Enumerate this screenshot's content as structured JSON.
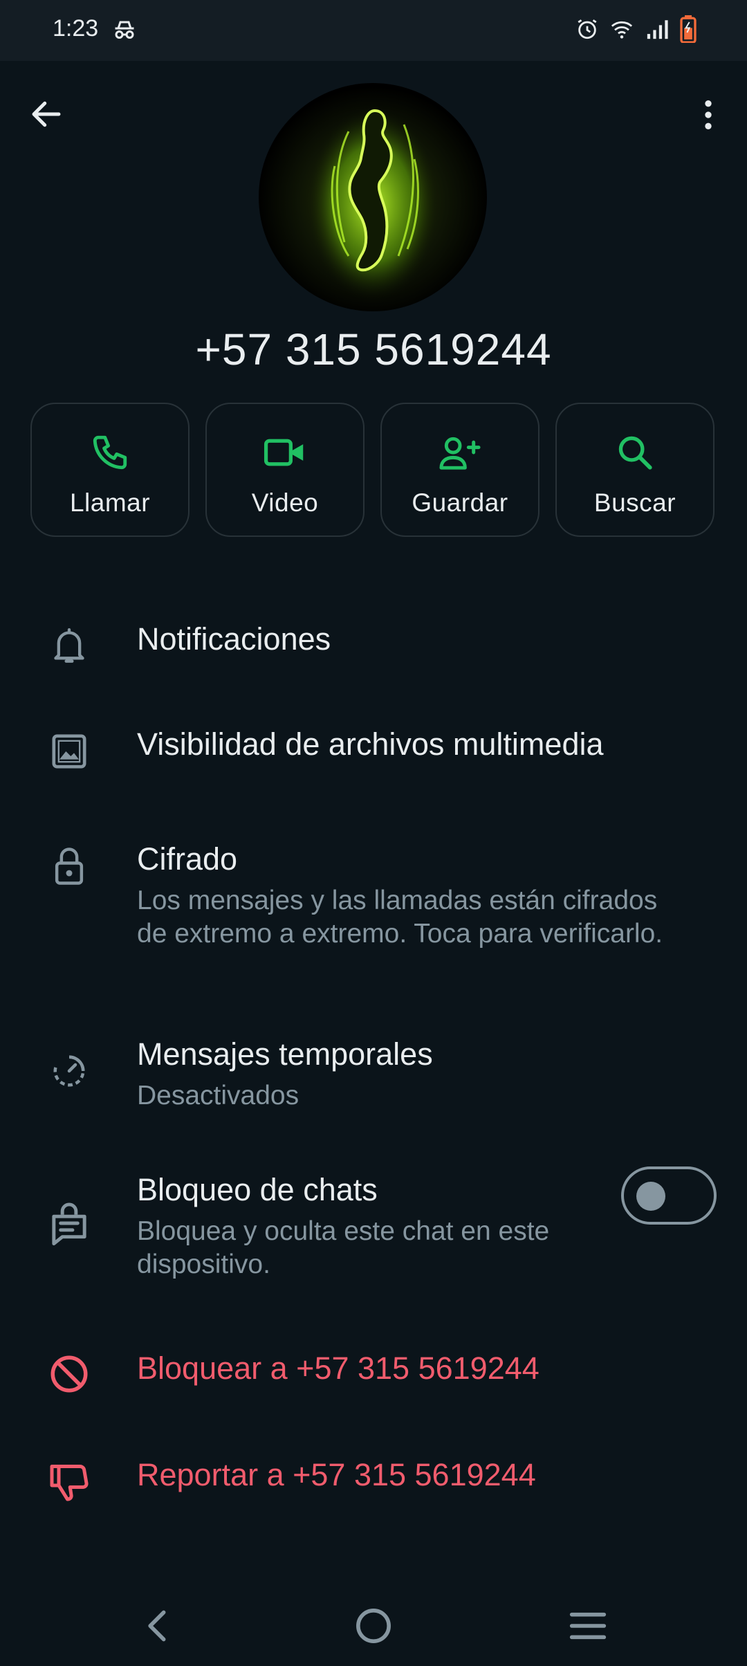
{
  "status_bar": {
    "time": "1:23",
    "icons": [
      "incognito-icon",
      "alarm-icon",
      "wifi-icon",
      "signal-icon",
      "battery-icon"
    ]
  },
  "top_bar": {
    "back_icon": "arrow-back-icon",
    "menu_icon": "more-vert-icon"
  },
  "contact": {
    "phone": "+57 315 5619244"
  },
  "actions": [
    {
      "label": "Llamar",
      "icon": "phone-icon"
    },
    {
      "label": "Video",
      "icon": "video-icon"
    },
    {
      "label": "Guardar",
      "icon": "add-person-icon"
    },
    {
      "label": "Buscar",
      "icon": "search-icon"
    }
  ],
  "settings": {
    "notifications": "Notificaciones",
    "media_visibility": "Visibilidad de archivos multimedia",
    "encryption": {
      "title": "Cifrado",
      "subtitle": "Los mensajes y las llamadas están cifrados de extremo a extremo. Toca para verificarlo."
    },
    "disappearing": {
      "title": "Mensajes temporales",
      "subtitle": "Desactivados"
    },
    "chat_lock": {
      "title": "Bloqueo de chats",
      "subtitle": "Bloquea y oculta este chat en este dispositivo.",
      "enabled": false
    },
    "block": "Bloquear a +57 315 5619244",
    "report": "Reportar a +57 315 5619244"
  },
  "colors": {
    "background": "#0b141a",
    "accent": "#21c063",
    "danger": "#f15c6d",
    "muted": "#8696a0"
  }
}
